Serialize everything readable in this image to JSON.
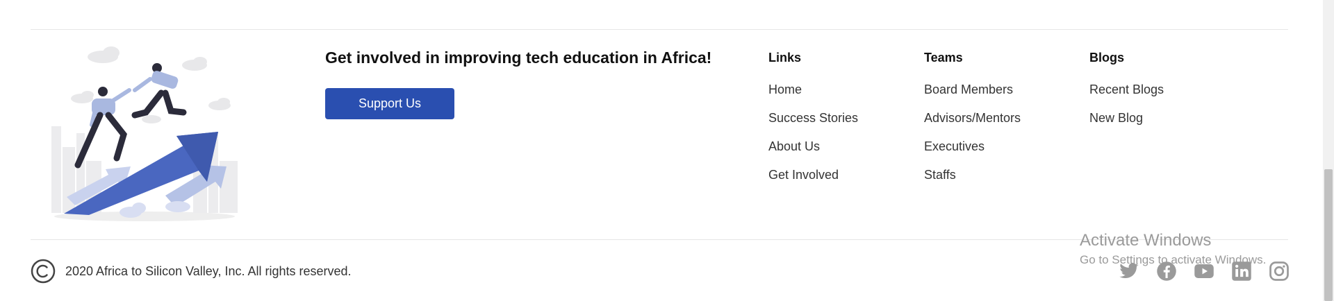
{
  "cta": {
    "heading": "Get involved in improving tech education in Africa!",
    "button_label": "Support Us"
  },
  "footer_columns": {
    "links": {
      "title": "Links",
      "items": [
        "Home",
        "Success Stories",
        "About Us",
        "Get Involved"
      ]
    },
    "teams": {
      "title": "Teams",
      "items": [
        "Board Members",
        "Advisors/Mentors",
        "Executives",
        "Staffs"
      ]
    },
    "blogs": {
      "title": "Blogs",
      "items": [
        "Recent Blogs",
        "New Blog"
      ]
    }
  },
  "copyright": {
    "icon": "copyright-icon",
    "text": "2020 Africa to Silicon Valley, Inc. All rights reserved."
  },
  "social": [
    "twitter-icon",
    "facebook-icon",
    "youtube-icon",
    "linkedin-icon",
    "instagram-icon"
  ],
  "watermark": {
    "line1": "Activate Windows",
    "line2": "Go to Settings to activate Windows."
  },
  "colors": {
    "accent": "#2a4fb0",
    "icon_gray": "#9a9a9a"
  }
}
